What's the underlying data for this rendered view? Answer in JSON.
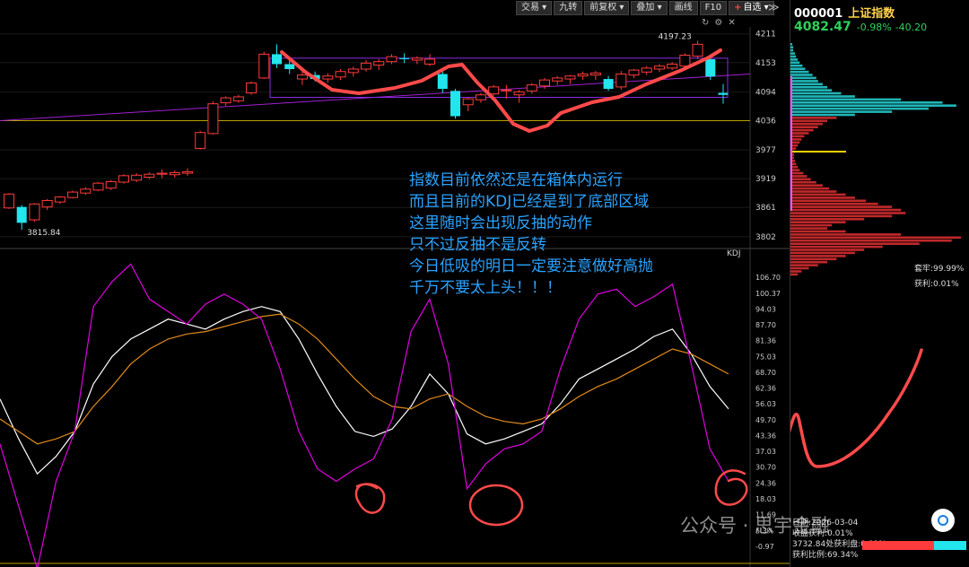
{
  "toolbar": {
    "items": [
      {
        "label": "交易 ▾"
      },
      {
        "label": "九转"
      },
      {
        "label": "前复权 ▾"
      },
      {
        "label": "叠加 ▾"
      },
      {
        "label": "画线"
      },
      {
        "label": "F10"
      }
    ],
    "watch_label": "自选 ▾",
    "more": "≫"
  },
  "stock": {
    "code": "000001",
    "name": "上证指数",
    "price": "4082.47",
    "change_pct": "-0.98%",
    "change": "-40.20"
  },
  "annotation": {
    "lines": [
      "指数目前依然还是在箱体内运行",
      "而且目前的KDJ已经是到了底部区域",
      "这里随时会出现反抽的动作",
      "只不过反抽不是反转",
      "今日低吸的明日一定要注意做好高抛",
      "千万不要太上头！！！"
    ]
  },
  "kdj_label": "KDJ",
  "chip": {
    "lock": "套牢:99.99%",
    "profit": "获利:0.01%",
    "info": [
      "日期:2026-03-04",
      "收盘获利:0.01%",
      "3732.84处获利盘:0.01%",
      "获利比例:69.34%"
    ]
  },
  "watermark": "公众号 · 思宇金融",
  "colors": {
    "up": "#ff3b3b",
    "down": "#22e5ee",
    "k": "#ffffff",
    "d": "#e08a1a",
    "j": "#e000e0",
    "box": "#8a2be2",
    "marker": "#ff4a4a",
    "annot": "#2ba3ff"
  },
  "chart_data": [
    {
      "type": "candlestick",
      "title": "上证指数",
      "ylim": [
        3780,
        4225
      ],
      "y_ticks": [
        "4211",
        "4153",
        "4094",
        "4036",
        "3977",
        "3919",
        "3861",
        "3802"
      ],
      "high_label": "4197.23",
      "low_label": "3815.84",
      "candles": [
        {
          "o": 3860,
          "h": 3890,
          "l": 3858,
          "c": 3888
        },
        {
          "o": 3862,
          "h": 3866,
          "l": 3816,
          "c": 3830
        },
        {
          "o": 3836,
          "h": 3870,
          "l": 3832,
          "c": 3868
        },
        {
          "o": 3862,
          "h": 3878,
          "l": 3856,
          "c": 3875
        },
        {
          "o": 3872,
          "h": 3884,
          "l": 3868,
          "c": 3882
        },
        {
          "o": 3881,
          "h": 3895,
          "l": 3879,
          "c": 3892
        },
        {
          "o": 3890,
          "h": 3902,
          "l": 3886,
          "c": 3898
        },
        {
          "o": 3896,
          "h": 3912,
          "l": 3894,
          "c": 3910
        },
        {
          "o": 3900,
          "h": 3916,
          "l": 3896,
          "c": 3913
        },
        {
          "o": 3912,
          "h": 3928,
          "l": 3909,
          "c": 3925
        },
        {
          "o": 3916,
          "h": 3930,
          "l": 3912,
          "c": 3926
        },
        {
          "o": 3922,
          "h": 3932,
          "l": 3918,
          "c": 3928
        },
        {
          "o": 3928,
          "h": 3938,
          "l": 3920,
          "c": 3930
        },
        {
          "o": 3927,
          "h": 3936,
          "l": 3921,
          "c": 3931
        },
        {
          "o": 3930,
          "h": 3940,
          "l": 3925,
          "c": 3933
        },
        {
          "o": 3980,
          "h": 4015,
          "l": 3978,
          "c": 4012
        },
        {
          "o": 4010,
          "h": 4075,
          "l": 4008,
          "c": 4070
        },
        {
          "o": 4072,
          "h": 4085,
          "l": 4066,
          "c": 4082
        },
        {
          "o": 4076,
          "h": 4088,
          "l": 4072,
          "c": 4084
        },
        {
          "o": 4092,
          "h": 4115,
          "l": 4088,
          "c": 4112
        },
        {
          "o": 4122,
          "h": 4175,
          "l": 4120,
          "c": 4170
        },
        {
          "o": 4170,
          "h": 4190,
          "l": 4142,
          "c": 4150
        },
        {
          "o": 4150,
          "h": 4160,
          "l": 4130,
          "c": 4140
        },
        {
          "o": 4120,
          "h": 4135,
          "l": 4108,
          "c": 4128
        },
        {
          "o": 4128,
          "h": 4135,
          "l": 4115,
          "c": 4120
        },
        {
          "o": 4120,
          "h": 4132,
          "l": 4112,
          "c": 4126
        },
        {
          "o": 4124,
          "h": 4140,
          "l": 4118,
          "c": 4135
        },
        {
          "o": 4133,
          "h": 4145,
          "l": 4125,
          "c": 4140
        },
        {
          "o": 4140,
          "h": 4158,
          "l": 4135,
          "c": 4152
        },
        {
          "o": 4148,
          "h": 4160,
          "l": 4138,
          "c": 4155
        },
        {
          "o": 4155,
          "h": 4170,
          "l": 4150,
          "c": 4165
        },
        {
          "o": 4162,
          "h": 4172,
          "l": 4152,
          "c": 4160
        },
        {
          "o": 4158,
          "h": 4166,
          "l": 4150,
          "c": 4162
        },
        {
          "o": 4150,
          "h": 4170,
          "l": 4146,
          "c": 4160
        },
        {
          "o": 4130,
          "h": 4140,
          "l": 4092,
          "c": 4100
        },
        {
          "o": 4096,
          "h": 4100,
          "l": 4040,
          "c": 4045
        },
        {
          "o": 4068,
          "h": 4082,
          "l": 4055,
          "c": 4080
        },
        {
          "o": 4078,
          "h": 4092,
          "l": 4072,
          "c": 4088
        },
        {
          "o": 4090,
          "h": 4108,
          "l": 4086,
          "c": 4104
        },
        {
          "o": 4098,
          "h": 4108,
          "l": 4080,
          "c": 4098
        },
        {
          "o": 4088,
          "h": 4098,
          "l": 4072,
          "c": 4094
        },
        {
          "o": 4096,
          "h": 4112,
          "l": 4090,
          "c": 4108
        },
        {
          "o": 4106,
          "h": 4122,
          "l": 4100,
          "c": 4118
        },
        {
          "o": 4116,
          "h": 4126,
          "l": 4108,
          "c": 4122
        },
        {
          "o": 4120,
          "h": 4128,
          "l": 4110,
          "c": 4126
        },
        {
          "o": 4126,
          "h": 4135,
          "l": 4118,
          "c": 4130
        },
        {
          "o": 4128,
          "h": 4136,
          "l": 4118,
          "c": 4132
        },
        {
          "o": 4120,
          "h": 4126,
          "l": 4096,
          "c": 4100
        },
        {
          "o": 4104,
          "h": 4136,
          "l": 4098,
          "c": 4130
        },
        {
          "o": 4128,
          "h": 4140,
          "l": 4122,
          "c": 4138
        },
        {
          "o": 4134,
          "h": 4146,
          "l": 4128,
          "c": 4142
        },
        {
          "o": 4140,
          "h": 4150,
          "l": 4134,
          "c": 4146
        },
        {
          "o": 4142,
          "h": 4154,
          "l": 4138,
          "c": 4150
        },
        {
          "o": 4146,
          "h": 4172,
          "l": 4144,
          "c": 4168
        },
        {
          "o": 4166,
          "h": 4197,
          "l": 4160,
          "c": 4190
        },
        {
          "o": 4160,
          "h": 4168,
          "l": 4118,
          "c": 4125
        },
        {
          "o": 4092,
          "h": 4110,
          "l": 4070,
          "c": 4088
        }
      ]
    },
    {
      "type": "line",
      "title": "KDJ",
      "ylim": [
        -5,
        110
      ],
      "y_ticks": [
        "106.70",
        "100.37",
        "94.03",
        "87.70",
        "81.36",
        "75.03",
        "68.70",
        "62.36",
        "56.03",
        "49.70",
        "43.36",
        "37.03",
        "30.70",
        "24.36",
        "18.03",
        "11.69",
        "5.3%",
        "-0.97"
      ],
      "series": [
        {
          "name": "K",
          "values": [
            58,
            42,
            28,
            35,
            45,
            64,
            75,
            82,
            86,
            90,
            88,
            86,
            90,
            93,
            95,
            93,
            82,
            68,
            55,
            45,
            43,
            46,
            55,
            68,
            60,
            44,
            40,
            42,
            45,
            48,
            56,
            66,
            70,
            74,
            78,
            83,
            86,
            76,
            63,
            54
          ]
        },
        {
          "name": "D",
          "values": [
            50,
            45,
            40,
            42,
            45,
            55,
            63,
            72,
            78,
            82,
            84,
            85,
            87,
            89,
            91,
            92,
            88,
            82,
            74,
            66,
            59,
            55,
            54,
            58,
            60,
            55,
            51,
            49,
            48,
            50,
            54,
            59,
            63,
            66,
            70,
            74,
            78,
            76,
            72,
            68
          ]
        },
        {
          "name": "J",
          "values": [
            40,
            15,
            -10,
            25,
            45,
            95,
            105,
            112,
            98,
            93,
            88,
            96,
            100,
            96,
            90,
            70,
            45,
            30,
            25,
            30,
            34,
            50,
            85,
            98,
            72,
            22,
            32,
            38,
            40,
            45,
            70,
            90,
            100,
            102,
            95,
            99,
            104,
            72,
            38,
            25
          ]
        }
      ]
    },
    {
      "type": "bar",
      "title": "筹码分布",
      "values": [
        2,
        3,
        3,
        5,
        6,
        8,
        10,
        13,
        16,
        20,
        24,
        28,
        30,
        35,
        40,
        45,
        55,
        70,
        120,
        165,
        180,
        150,
        110,
        70,
        50,
        40,
        35,
        30,
        25,
        20,
        15,
        12,
        10,
        8,
        6,
        5,
        4,
        4,
        5,
        6,
        8,
        10,
        14,
        18,
        22,
        28,
        35,
        42,
        50,
        60,
        70,
        82,
        95,
        110,
        120,
        125,
        110,
        80,
        60,
        45,
        40,
        60,
        120,
        185,
        175,
        140,
        100,
        80,
        70,
        60,
        50,
        40,
        30,
        20,
        12,
        8
      ]
    }
  ]
}
